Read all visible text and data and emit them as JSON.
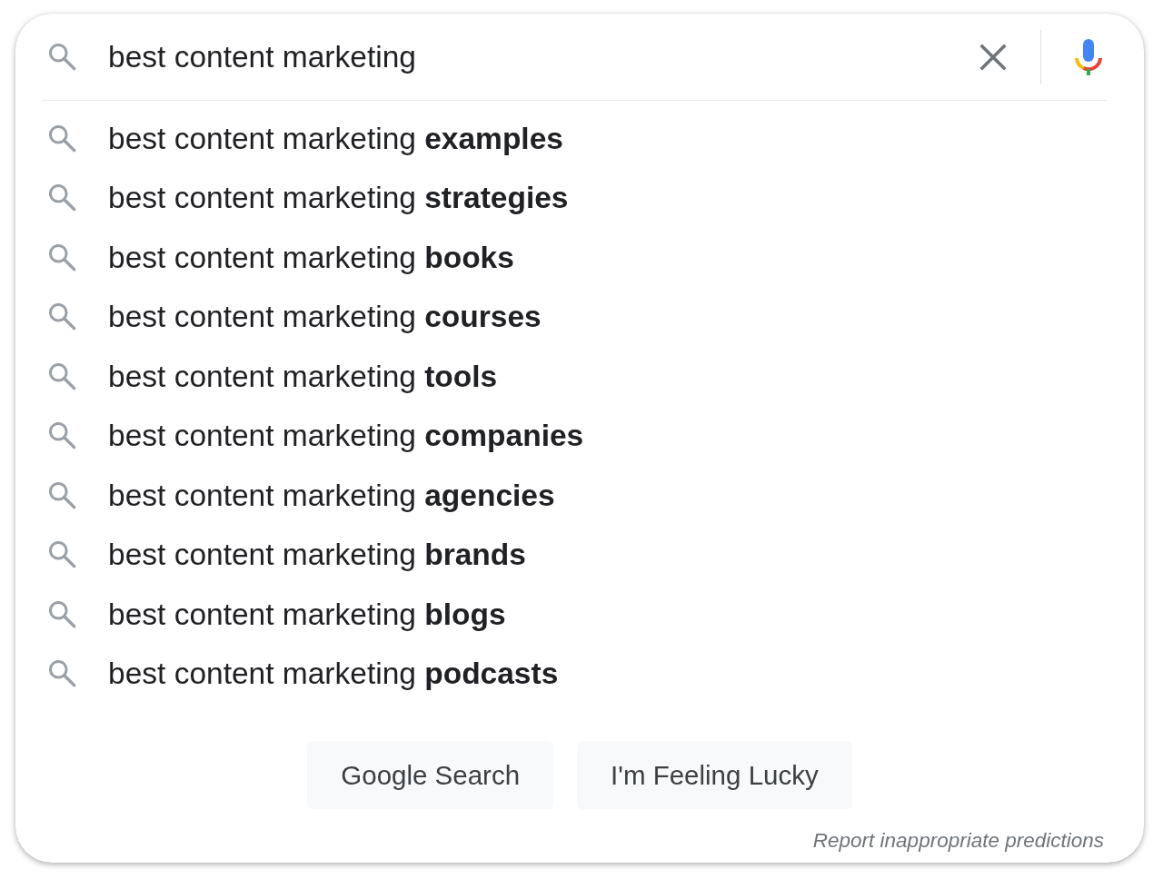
{
  "search": {
    "value": "best content marketing"
  },
  "suggestions": [
    {
      "text": "best content marketing **examples**"
    },
    {
      "text": "best content marketing **strategies**"
    },
    {
      "text": "best content marketing **books**"
    },
    {
      "text": "best content marketing **courses**"
    },
    {
      "text": "best content marketing **tools**"
    },
    {
      "text": "best content marketing **companies**"
    },
    {
      "text": "best content marketing **agencies**"
    },
    {
      "text": "best content marketing **brands**"
    },
    {
      "text": "best content marketing **blogs**"
    },
    {
      "text": "best content marketing **podcasts**"
    }
  ],
  "buttons": [
    "Google Search",
    "I'm Feeling Lucky"
  ],
  "report_link": "Report inappropriate predictions"
}
